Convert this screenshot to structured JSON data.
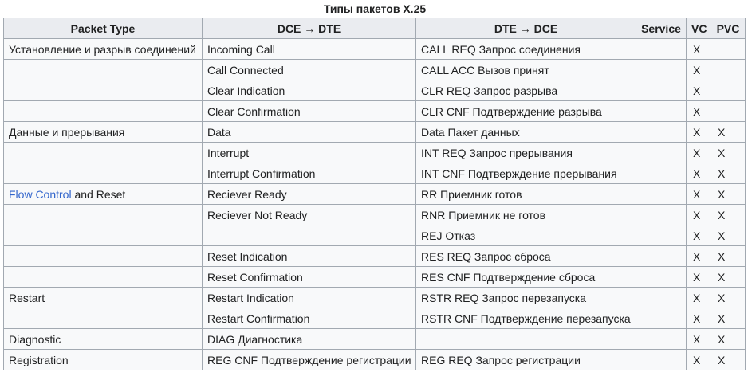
{
  "caption": "Типы пакетов X.25",
  "headers": {
    "packet_type": "Packet Type",
    "dce_dte": "DCE → DTE",
    "dte_dce": "DTE → DCE",
    "service": "Service",
    "vc": "VC",
    "pvc": "PVC"
  },
  "rows": [
    {
      "type": "Установление и разрыв соединений",
      "type_link": "",
      "type_suffix": "",
      "dce": "Incoming Call",
      "dte": "CALL REQ Запрос соединения",
      "service": "",
      "vc": "X",
      "pvc": ""
    },
    {
      "type": "",
      "type_link": "",
      "type_suffix": "",
      "dce": "Call Connected",
      "dte": "CALL ACC Вызов принят",
      "service": "",
      "vc": "X",
      "pvc": ""
    },
    {
      "type": "",
      "type_link": "",
      "type_suffix": "",
      "dce": "Clear Indication",
      "dte": "CLR REQ Запрос разрыва",
      "service": "",
      "vc": "X",
      "pvc": ""
    },
    {
      "type": "",
      "type_link": "",
      "type_suffix": "",
      "dce": "Clear Confirmation",
      "dte": "CLR CNF Подтверждение разрыва",
      "service": "",
      "vc": "X",
      "pvc": ""
    },
    {
      "type": "Данные и прерывания",
      "type_link": "",
      "type_suffix": "",
      "dce": "Data",
      "dte": "Data Пакет данных",
      "service": "",
      "vc": "X",
      "pvc": "X"
    },
    {
      "type": "",
      "type_link": "",
      "type_suffix": "",
      "dce": "Interrupt",
      "dte": "INT REQ Запрос прерывания",
      "service": "",
      "vc": "X",
      "pvc": "X"
    },
    {
      "type": "",
      "type_link": "",
      "type_suffix": "",
      "dce": "Interrupt Confirmation",
      "dte": "INT CNF Подтверждение прерывания",
      "service": "",
      "vc": "X",
      "pvc": "X"
    },
    {
      "type": "",
      "type_link": "Flow Control",
      "type_suffix": " and Reset",
      "dce": "Reciever Ready",
      "dte": "RR Приемник готов",
      "service": "",
      "vc": "X",
      "pvc": "X"
    },
    {
      "type": "",
      "type_link": "",
      "type_suffix": "",
      "dce": "Reciever Not Ready",
      "dte": "RNR Приемник не готов",
      "service": "",
      "vc": "X",
      "pvc": "X"
    },
    {
      "type": "",
      "type_link": "",
      "type_suffix": "",
      "dce": "",
      "dte": "REJ Отказ",
      "service": "",
      "vc": "X",
      "pvc": "X"
    },
    {
      "type": "",
      "type_link": "",
      "type_suffix": "",
      "dce": "Reset Indication",
      "dte": "RES REQ Запрос сброса",
      "service": "",
      "vc": "X",
      "pvc": "X"
    },
    {
      "type": "",
      "type_link": "",
      "type_suffix": "",
      "dce": "Reset Confirmation",
      "dte": "RES CNF Подтверждение сброса",
      "service": "",
      "vc": "X",
      "pvc": "X"
    },
    {
      "type": "Restart",
      "type_link": "",
      "type_suffix": "",
      "dce": "Restart Indication",
      "dte": "RSTR REQ Запрос перезапуска",
      "service": "",
      "vc": "X",
      "pvc": "X"
    },
    {
      "type": "",
      "type_link": "",
      "type_suffix": "",
      "dce": "Restart Confirmation",
      "dte": "RSTR CNF Подтверждение перезапуска",
      "service": "",
      "vc": "X",
      "pvc": "X"
    },
    {
      "type": "Diagnostic",
      "type_link": "",
      "type_suffix": "",
      "dce": "DIAG Диагностика",
      "dte": "",
      "service": "",
      "vc": "X",
      "pvc": "X"
    },
    {
      "type": "Registration",
      "type_link": "",
      "type_suffix": "",
      "dce": "REG CNF Подтверждение регистрации",
      "dte": "REG REQ Запрос регистрации",
      "service": "",
      "vc": "X",
      "pvc": "X"
    }
  ]
}
